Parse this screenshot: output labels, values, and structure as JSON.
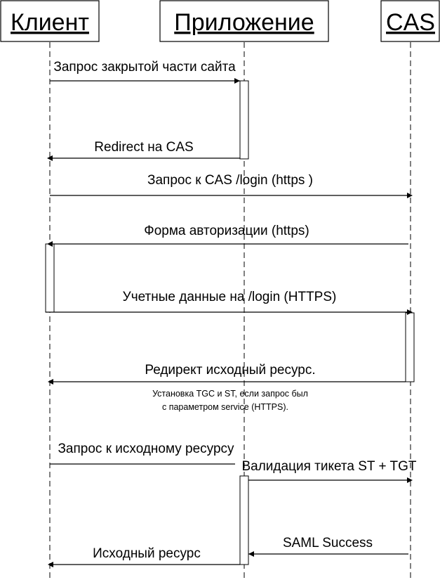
{
  "diagram": {
    "type": "sequence",
    "colors": {
      "line": "#000000",
      "background": "#ffffff"
    },
    "actors": [
      {
        "id": "client",
        "label": "Клиент"
      },
      {
        "id": "app",
        "label": "Приложение"
      },
      {
        "id": "cas",
        "label": "CAS"
      }
    ],
    "messages": [
      {
        "from": "client",
        "to": "app",
        "label": "Запрос закрытой части сайта"
      },
      {
        "from": "app",
        "to": "client",
        "label": "Redirect на CAS"
      },
      {
        "from": "client",
        "to": "cas",
        "label": "Запрос к CAS /login  (https )"
      },
      {
        "from": "cas",
        "to": "client",
        "label": "Форма авторизации (https)"
      },
      {
        "from": "client",
        "to": "cas",
        "label": "Учетные данные на  /login (HTTPS)"
      },
      {
        "from": "cas",
        "to": "client",
        "label": "Редирект исходный ресурс."
      },
      {
        "from": "client",
        "to": "app",
        "label": "Запрос к исходному ресурсу"
      },
      {
        "from": "app",
        "to": "cas",
        "label": "Валидация тикета ST + TGT"
      },
      {
        "from": "cas",
        "to": "app",
        "label": "SAML Success"
      },
      {
        "from": "app",
        "to": "client",
        "label": "Исходный ресурс"
      }
    ],
    "notes": [
      {
        "lines": [
          "Установка TGC и  ST, если запрос был",
          "с параметром service (HTTPS)."
        ]
      }
    ]
  }
}
